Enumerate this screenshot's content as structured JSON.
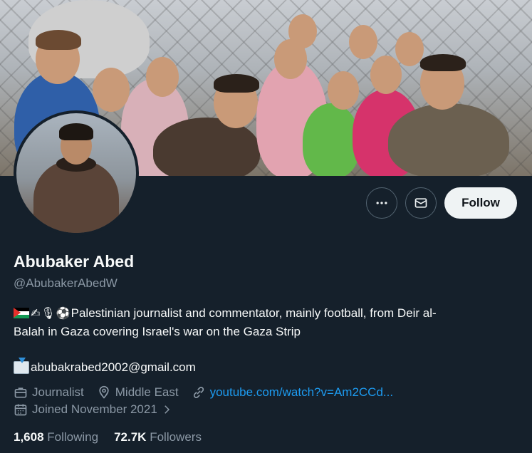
{
  "profile": {
    "name": "Abubaker Abed",
    "handle": "@AbubakerAbedW",
    "bio_line1": "Palestinian journalist and commentator, mainly football, from Deir al-",
    "bio_line2": "Balah in Gaza covering Israel's war on the Gaza Strip",
    "email": "abubakrabed2002@gmail.com",
    "profession": "Journalist",
    "location": "Middle East",
    "website": "youtube.com/watch?v=Am2CCd...",
    "joined": "Joined November 2021"
  },
  "actions": {
    "follow_label": "Follow",
    "more_icon": "more-icon",
    "message_icon": "mail-icon"
  },
  "stats": {
    "following_count": "1,608",
    "following_label": "Following",
    "followers_count": "72.7K",
    "followers_label": "Followers"
  },
  "colors": {
    "background": "#15202b",
    "link": "#1d9bf0",
    "muted": "#8b98a5",
    "follow_button": "#eff3f4"
  }
}
